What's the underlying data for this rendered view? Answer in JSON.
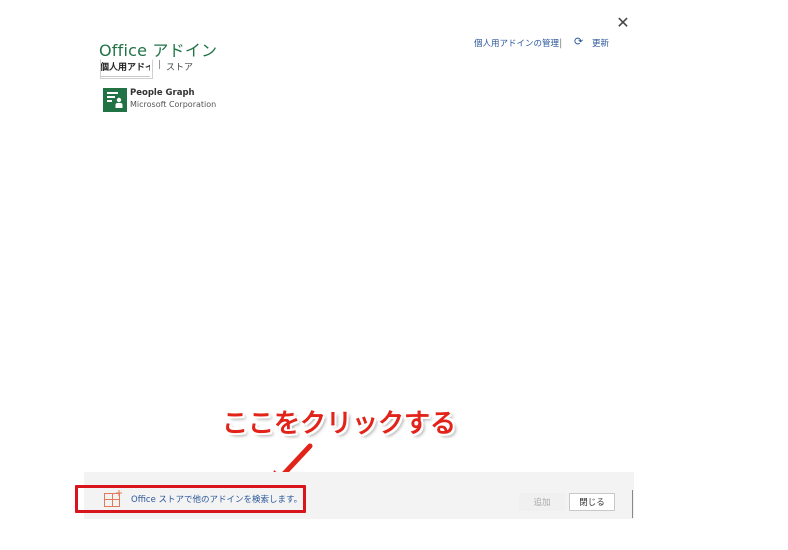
{
  "dialog": {
    "title": "Office アドイン",
    "close_icon": "close-icon"
  },
  "tabs": [
    {
      "label": "個人用アドイン",
      "active": true
    },
    {
      "label": "ストア",
      "active": false
    }
  ],
  "tab_separator": "|",
  "header_links": {
    "manage_label": "個人用アドインの管理",
    "separator": "|",
    "refresh_icon": "refresh-icon",
    "refresh_label": "更新"
  },
  "addins": [
    {
      "name": "People Graph",
      "publisher": "Microsoft Corporation",
      "icon": "people-graph-icon",
      "icon_color": "#217346"
    }
  ],
  "annotation": {
    "callout_text": "ここをクリックする",
    "color": "#e2231a"
  },
  "footer": {
    "store_link_label": "Office ストアで他のアドインを検索します。",
    "store_icon": "store-icon",
    "add_button_label": "追加",
    "close_button_label": "閉じる"
  },
  "colors": {
    "accent": "#217346",
    "link": "#2b579a",
    "highlight": "#d8141c"
  }
}
